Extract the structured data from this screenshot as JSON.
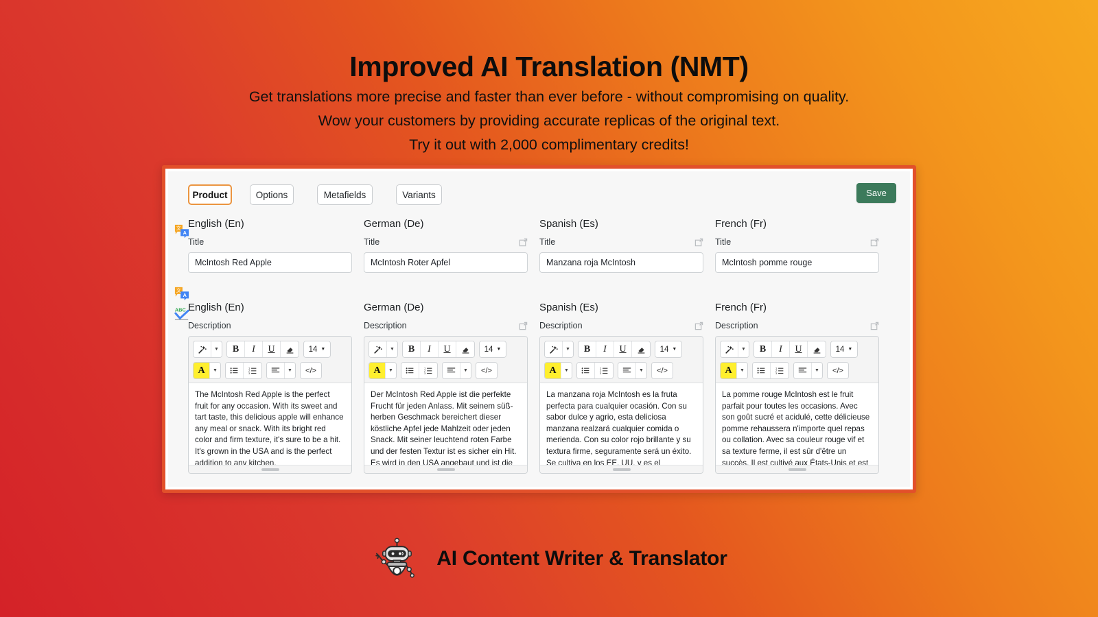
{
  "hero": {
    "title": "Improved AI Translation (NMT)",
    "line1": "Get translations more precise and faster than ever before - without compromising on quality.",
    "line2": "Wow your customers by providing accurate replicas of the original text.",
    "line3": "Try it out with 2,000 complimentary credits!"
  },
  "colors": {
    "gradient_start": "#d42228",
    "gradient_end": "#f7a91f",
    "card_border": "#e2502a",
    "tab_active_border": "#eb9440",
    "save_button": "#3c7a5b",
    "highlight_yellow": "#ffef2e"
  },
  "app": {
    "tabs": [
      {
        "label": "Product",
        "active": true
      },
      {
        "label": "Options",
        "active": false
      },
      {
        "label": "Metafields",
        "active": false
      },
      {
        "label": "Variants",
        "active": false
      }
    ],
    "save_label": "Save",
    "gutter_icons": [
      {
        "name": "translate-icon",
        "row": "title"
      },
      {
        "name": "translate-icon",
        "row": "description"
      },
      {
        "name": "spellcheck-icon",
        "row": "description"
      }
    ],
    "title_row": {
      "field_label": "Title",
      "columns": [
        {
          "language": "English (En)",
          "value": "McIntosh Red Apple",
          "has_external_link": false
        },
        {
          "language": "German (De)",
          "value": "McIntosh Roter Apfel",
          "has_external_link": true
        },
        {
          "language": "Spanish (Es)",
          "value": "Manzana roja McIntosh",
          "has_external_link": true
        },
        {
          "language": "French (Fr)",
          "value": "McIntosh pomme rouge",
          "has_external_link": true
        }
      ]
    },
    "description_row": {
      "field_label": "Description",
      "toolbar": {
        "magic_wand": "magic-wand-icon",
        "bold": "B",
        "italic": "I",
        "underline": "U",
        "eraser": "eraser-icon",
        "font_size": "14",
        "highlight_letter": "A",
        "bullet_list": "bullet-list-icon",
        "numbered_list": "numbered-list-icon",
        "align": "align-left-icon",
        "code": "</>"
      },
      "columns": [
        {
          "language": "English (En)",
          "has_external_link": false,
          "text": "The McIntosh Red Apple is the perfect fruit for any occasion. With its sweet and tart taste, this delicious apple will enhance any meal or snack. With its bright red color and firm texture, it's sure to be a hit. It's grown in the USA and is the perfect addition to any kitchen."
        },
        {
          "language": "German (De)",
          "has_external_link": true,
          "text": "Der McIntosh Red Apple ist die perfekte Frucht für jeden Anlass. Mit seinem süß-herben Geschmack bereichert dieser köstliche Apfel jede Mahlzeit oder jeden Snack. Mit seiner leuchtend roten Farbe und der festen Textur ist es sicher ein Hit. Es wird in den USA angebaut und ist die"
        },
        {
          "language": "Spanish (Es)",
          "has_external_link": true,
          "text": "La manzana roja McIntosh es la fruta perfecta para cualquier ocasión. Con su sabor dulce y agrio, esta deliciosa manzana realzará cualquier comida o merienda. Con su color rojo brillante y su textura firme, seguramente será un éxito. Se cultiva en los EE. UU. y es el complemento perfecto para"
        },
        {
          "language": "French (Fr)",
          "has_external_link": true,
          "text": "La pomme rouge McIntosh est le fruit parfait pour toutes les occasions. Avec son goût sucré et acidulé, cette délicieuse pomme rehaussera n'importe quel repas ou collation. Avec sa couleur rouge vif et sa texture ferme, il est sûr d'être un succès. Il est cultivé aux États-Unis et est le"
        }
      ]
    }
  },
  "brand": {
    "icon": "robot-mascot-icon",
    "name": "AI Content Writer & Translator"
  }
}
